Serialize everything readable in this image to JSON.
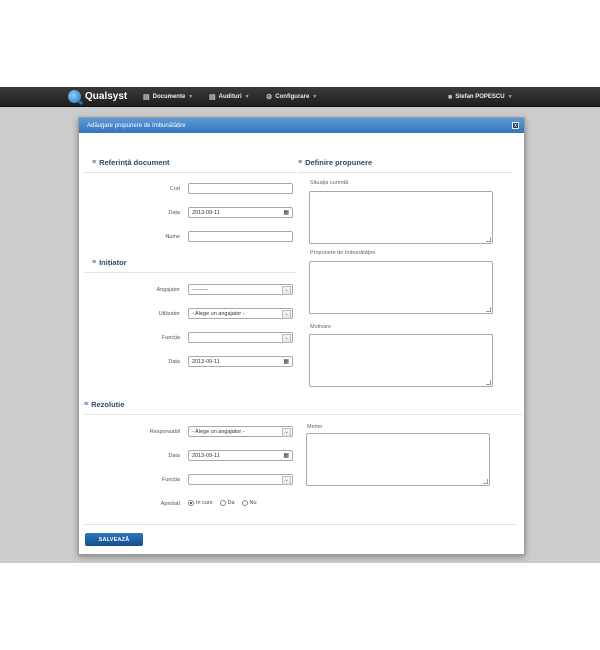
{
  "navbar": {
    "brand": "Qualsyst",
    "menu": [
      {
        "label": "Documente",
        "icon": "document-icon"
      },
      {
        "label": "Audituri",
        "icon": "clipboard-icon"
      },
      {
        "label": "Configurare",
        "icon": "gear-icon"
      }
    ],
    "user": {
      "label": "Stefan POPESCU",
      "icon": "user-icon"
    }
  },
  "modal": {
    "title": "Adăugare propunere de îmbunătățire",
    "close_label": "x",
    "referinta": {
      "title": "Referință document",
      "cod": {
        "label": "Cod",
        "value": ""
      },
      "data": {
        "label": "Data",
        "value": "2013-09-11"
      },
      "nume": {
        "label": "Nume",
        "value": ""
      }
    },
    "initiator": {
      "title": "Inițiator",
      "angajator": {
        "label": "Angajator",
        "value": "---------"
      },
      "utilizator": {
        "label": "Utilizator",
        "value": "- Alege un angajator -"
      },
      "functia": {
        "label": "Funcția",
        "value": ""
      },
      "data": {
        "label": "Data",
        "value": "2013-09-11"
      }
    },
    "definire": {
      "title": "Definire propunere",
      "situatia": {
        "label": "Situația curentă"
      },
      "propunere": {
        "label": "Propunere de îmbunătățire"
      },
      "motivare": {
        "label": "Motivare"
      }
    },
    "rezolutie": {
      "title": "Rezolutie",
      "responsabil": {
        "label": "Responsabil",
        "value": "- Alege un angajator -"
      },
      "data": {
        "label": "Data",
        "value": "2013-09-11"
      },
      "functia": {
        "label": "Funcția",
        "value": ""
      },
      "aprobat": {
        "label": "Aprobat",
        "options": [
          "In curs",
          "Da",
          "Nu"
        ],
        "selected": "In curs"
      },
      "memo": {
        "label": "Memo"
      }
    },
    "save_label": "SALVEAZĂ"
  }
}
